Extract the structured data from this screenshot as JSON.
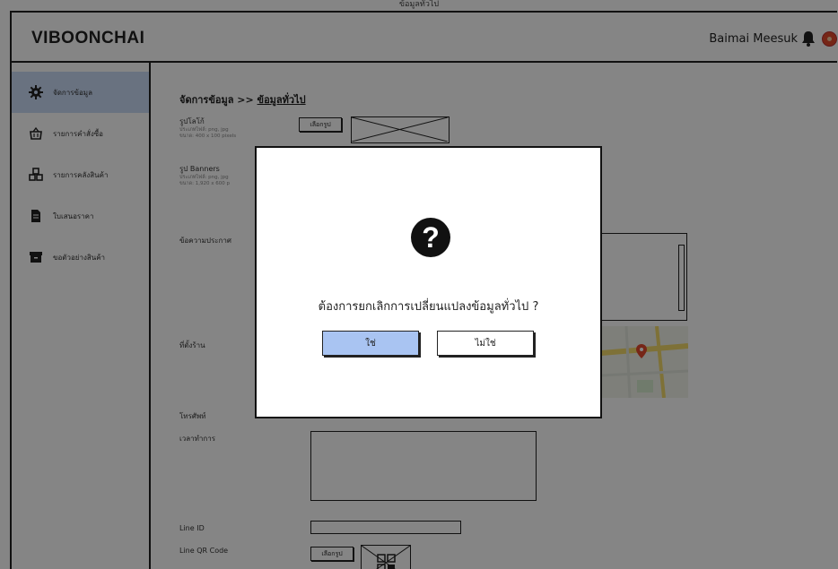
{
  "page": {
    "tab_title": "ข้อมูลทั่วไป"
  },
  "header": {
    "brand": "VIBOONCHAI",
    "user_name": "Baimai Meesuk"
  },
  "sidebar": {
    "items": [
      {
        "label": "จัดการข้อมูล",
        "icon": "gear-icon",
        "active": true
      },
      {
        "label": "รายการคำสั่งซื้อ",
        "icon": "basket-icon",
        "active": false
      },
      {
        "label": "รายการคลังสินค้า",
        "icon": "boxes-icon",
        "active": false
      },
      {
        "label": "ใบเสนอราคา",
        "icon": "document-icon",
        "active": false
      },
      {
        "label": "ขอตัวอย่างสินค้า",
        "icon": "archive-icon",
        "active": false
      }
    ]
  },
  "main": {
    "breadcrumb_root": "จัดการข้อมูล >> ",
    "breadcrumb_current": "ข้อมูลทั่วไป",
    "logo": {
      "label": "รูปโลโก้",
      "hint1": "ประเภทไฟล์: png, jpg",
      "hint2": "ขนาด: 400 x 100 pixels",
      "button": "เลือกรูป"
    },
    "banners": {
      "label": "รูป Banners",
      "hint1": "ประเภทไฟล์: png, jpg",
      "hint2": "ขนาด: 1,920 x 600 p"
    },
    "announcement_label": "ข้อความประกาศ",
    "location_label": "ที่ตั้งร้าน",
    "phone_label": "โทรศัพท์",
    "hours_label": "เวลาทำการ",
    "line_id_label": "Line ID",
    "line_qr_label": "Line QR Code",
    "qr_button": "เลือกรูป"
  },
  "dialog": {
    "message": "ต้องการยกเลิกการเปลี่ยนแปลงข้อมูลทั่วไป ?",
    "yes_label": "ใช่",
    "no_label": "ไม่ใช่",
    "icon": "question-icon",
    "yes_color": "#a9c4f2"
  },
  "colors": {
    "active_nav": "#c9daf5",
    "badge": "#e24a2c",
    "map_pin": "#e24a2c"
  }
}
